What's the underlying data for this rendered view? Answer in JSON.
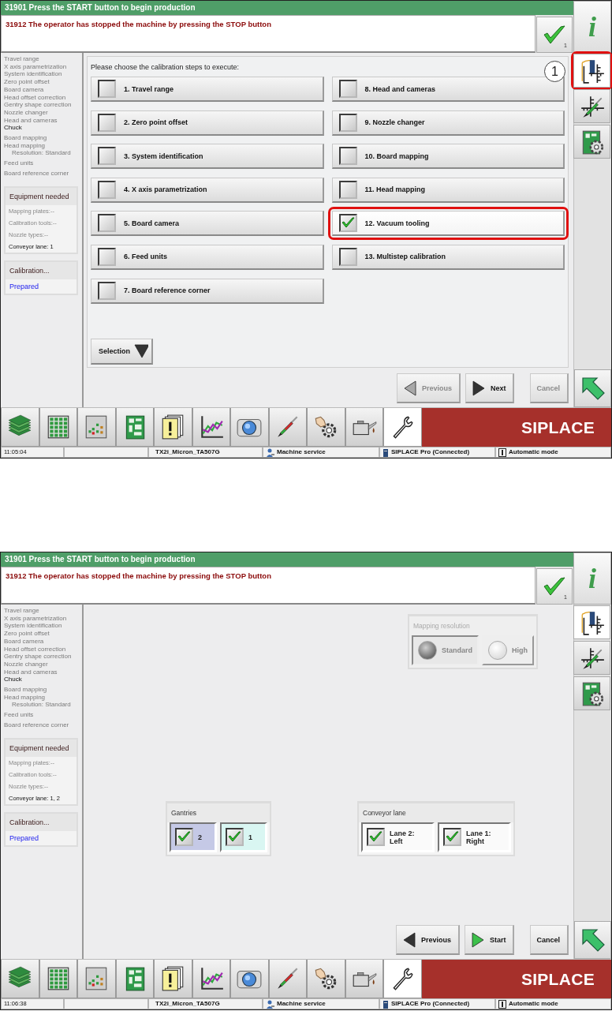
{
  "screens": [
    {
      "header": {
        "message": "31901 Press the START button to begin production",
        "alert": "31912 The operator has stopped the machine by pressing the STOP button",
        "confirm_count": "1",
        "info_label": "i"
      },
      "sidebar": {
        "step_groups": [
          [
            {
              "label": "Travel range",
              "highlighted": false
            },
            {
              "label": "X axis parametrization",
              "highlighted": false
            },
            {
              "label": "System identification",
              "highlighted": false
            },
            {
              "label": "Zero point offset",
              "highlighted": false
            },
            {
              "label": "Board camera",
              "highlighted": false
            },
            {
              "label": "Head offset correction",
              "highlighted": false
            },
            {
              "label": "Gentry shape correction",
              "highlighted": false
            },
            {
              "label": "Nozzle changer",
              "highlighted": false
            },
            {
              "label": "Head and cameras",
              "highlighted": false
            },
            {
              "label": "Chuck",
              "highlighted": true
            }
          ],
          [
            {
              "label": "Board mapping",
              "highlighted": false
            },
            {
              "label": "Head mapping",
              "highlighted": false,
              "children": [
                {
                  "label": "Resolution: Standard",
                  "highlighted": false
                }
              ]
            }
          ],
          [
            {
              "label": "Feed units",
              "highlighted": false
            }
          ],
          [
            {
              "label": "Board reference corner",
              "highlighted": false
            }
          ]
        ],
        "equipment": {
          "title": "Equipment needed",
          "rows": [
            {
              "text": "Mapping plates:--",
              "highlighted": false
            },
            {
              "text": "Calibration tools:--",
              "highlighted": false
            },
            {
              "text": "Nozzle types:--",
              "highlighted": false
            },
            {
              "text": "Conveyor lane: 1",
              "highlighted": true
            }
          ]
        },
        "calibration": {
          "title": "Calibration...",
          "status": "Prepared"
        }
      },
      "main": {
        "kind": "steps",
        "prompt": "Please choose the calibration steps to execute:",
        "columns": [
          [
            {
              "label": "1. Travel range",
              "checked": false,
              "annotated": false
            },
            {
              "label": "2. Zero point offset",
              "checked": false,
              "annotated": false
            },
            {
              "label": "3. System identification",
              "checked": false,
              "annotated": false
            },
            {
              "label": "4. X axis parametrization",
              "checked": false,
              "annotated": false
            },
            {
              "label": "5. Board camera",
              "checked": false,
              "annotated": false
            },
            {
              "label": "6. Feed units",
              "checked": false,
              "annotated": false
            },
            {
              "label": "7. Board reference corner",
              "checked": false,
              "annotated": false
            }
          ],
          [
            {
              "label": "8. Head and cameras",
              "checked": false,
              "annotated": false
            },
            {
              "label": "9. Nozzle changer",
              "checked": false,
              "annotated": false
            },
            {
              "label": "10. Board mapping",
              "checked": false,
              "annotated": false
            },
            {
              "label": "11. Head mapping",
              "checked": false,
              "annotated": false
            },
            {
              "label": "12. Vacuum tooling",
              "checked": true,
              "annotated": true
            },
            {
              "label": "13. Multistep calibration",
              "checked": false,
              "annotated": false
            }
          ]
        ],
        "selection_button": "Selection"
      },
      "nav": [
        {
          "kind": "previous",
          "label": "Previous",
          "disabled": true
        },
        {
          "kind": "next",
          "label": "Next",
          "disabled": false
        },
        {
          "kind": "cancel",
          "label": "Cancel",
          "disabled": true
        }
      ],
      "tool_tabs": [
        {
          "selected": true,
          "annotated": true,
          "callout": "1"
        },
        {
          "selected": false,
          "annotated": false
        },
        {
          "selected": false,
          "annotated": false
        }
      ],
      "toolbar": {
        "items": [
          {
            "selected": false
          },
          {
            "selected": false
          },
          {
            "selected": false
          },
          {
            "selected": false
          },
          {
            "selected": false
          },
          {
            "selected": false
          },
          {
            "selected": false
          },
          {
            "selected": false
          },
          {
            "selected": false
          },
          {
            "selected": false
          },
          {
            "selected": true
          }
        ],
        "brand": "SIPLACE"
      },
      "status_bar": {
        "time": "11:05:04",
        "station": "TX2i_Micron_TA507G",
        "user": "Machine service",
        "connection": "SIPLACE Pro (Connected)",
        "mode": "Automatic mode"
      }
    },
    {
      "header": {
        "message": "31901 Press the START button to begin production",
        "alert": "31912 The operator has stopped the machine by pressing the STOP button",
        "confirm_count": "1",
        "info_label": "i"
      },
      "sidebar": {
        "step_groups": [
          [
            {
              "label": "Travel range",
              "highlighted": false
            },
            {
              "label": "X axis parametrization",
              "highlighted": false
            },
            {
              "label": "System identification",
              "highlighted": false
            },
            {
              "label": "Zero point offset",
              "highlighted": false
            },
            {
              "label": "Board camera",
              "highlighted": false
            },
            {
              "label": "Head offset correction",
              "highlighted": false
            },
            {
              "label": "Gentry shape correction",
              "highlighted": false
            },
            {
              "label": "Nozzle changer",
              "highlighted": false
            },
            {
              "label": "Head and cameras",
              "highlighted": false
            },
            {
              "label": "Chuck",
              "highlighted": true
            }
          ],
          [
            {
              "label": "Board mapping",
              "highlighted": false
            },
            {
              "label": "Head mapping",
              "highlighted": false,
              "children": [
                {
                  "label": "Resolution: Standard",
                  "highlighted": false
                }
              ]
            }
          ],
          [
            {
              "label": "Feed units",
              "highlighted": false
            }
          ],
          [
            {
              "label": "Board reference corner",
              "highlighted": false
            }
          ]
        ],
        "equipment": {
          "title": "Equipment needed",
          "rows": [
            {
              "text": "Mapping plates:--",
              "highlighted": false
            },
            {
              "text": "Calibration tools:--",
              "highlighted": false
            },
            {
              "text": "Nozzle types:--",
              "highlighted": false
            },
            {
              "text": "Conveyor lane: 1, 2",
              "highlighted": true
            }
          ]
        },
        "calibration": {
          "title": "Calibration...",
          "status": "Prepared"
        }
      },
      "main": {
        "kind": "options",
        "resolution": {
          "title": "Mapping resolution",
          "disabled": true,
          "options": [
            {
              "label": "Standard",
              "selected": true
            },
            {
              "label": "High",
              "selected": false
            }
          ]
        },
        "groups": [
          {
            "title": "Gantries",
            "items": [
              {
                "label": "2",
                "checked": true,
                "color": "#c5c9e6"
              },
              {
                "label": "1",
                "checked": true,
                "color": "#d9f6f2"
              }
            ]
          },
          {
            "title": "Conveyor lane",
            "items": [
              {
                "label": "Lane 2: Left",
                "checked": true
              },
              {
                "label": "Lane 1: Right",
                "checked": true
              }
            ]
          }
        ]
      },
      "nav": [
        {
          "kind": "previous",
          "label": "Previous",
          "disabled": false
        },
        {
          "kind": "start",
          "label": "Start",
          "disabled": false
        },
        {
          "kind": "cancel",
          "label": "Cancel",
          "disabled": false
        }
      ],
      "tool_tabs": [
        {
          "selected": true,
          "annotated": false
        },
        {
          "selected": false,
          "annotated": false
        },
        {
          "selected": false,
          "annotated": false
        }
      ],
      "toolbar": {
        "items": [
          {
            "selected": false
          },
          {
            "selected": false
          },
          {
            "selected": false
          },
          {
            "selected": false
          },
          {
            "selected": false
          },
          {
            "selected": false
          },
          {
            "selected": false
          },
          {
            "selected": false
          },
          {
            "selected": false
          },
          {
            "selected": false
          },
          {
            "selected": true
          }
        ],
        "brand": "SIPLACE"
      },
      "status_bar": {
        "time": "11:06:38",
        "station": "TX2i_Micron_TA507G",
        "user": "Machine service",
        "connection": "SIPLACE Pro (Connected)",
        "mode": "Automatic mode"
      }
    }
  ]
}
